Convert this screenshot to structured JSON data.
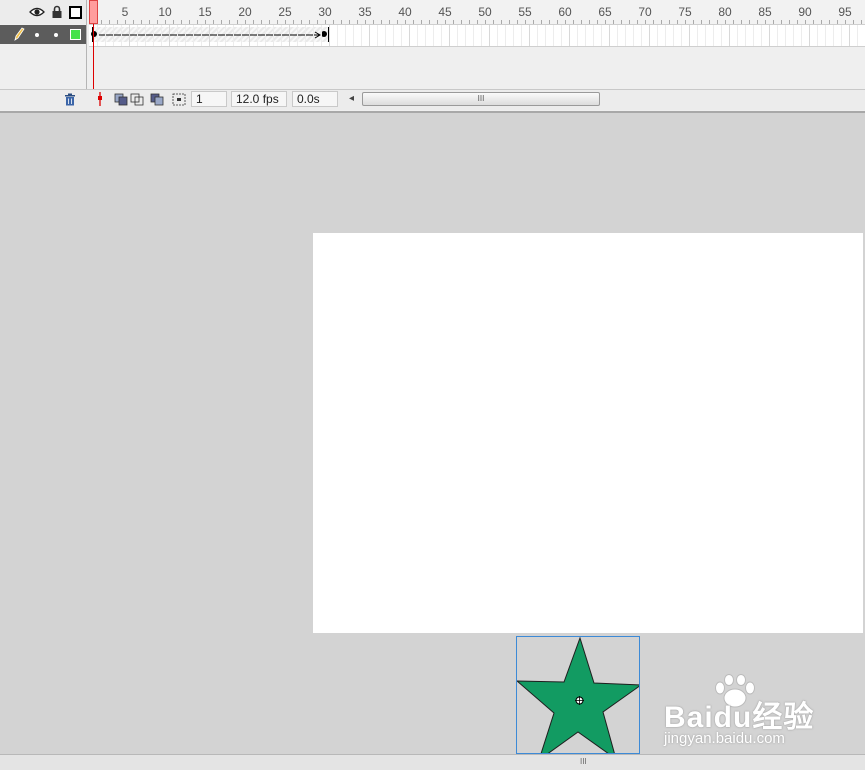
{
  "timeline": {
    "ruler_labels": [
      "1",
      "5",
      "10",
      "15",
      "20",
      "25",
      "30",
      "35",
      "40",
      "45",
      "50",
      "55",
      "60",
      "65",
      "70",
      "75",
      "80",
      "85",
      "90",
      "95"
    ],
    "layer": {
      "color": "#46e24b"
    },
    "status": {
      "current_frame": "1",
      "frame_rate": "12.0 fps",
      "elapsed_time": "0.0s",
      "scroll_left_glyph": "◂",
      "scroll_thumb_grip": "III"
    }
  },
  "stage": {
    "background": "#ffffff",
    "star_color": "#129b62"
  },
  "bottom_bar": {
    "grip": "III"
  },
  "watermark": {
    "brand": "Baidu经验",
    "url": "jingyan.baidu.com"
  }
}
